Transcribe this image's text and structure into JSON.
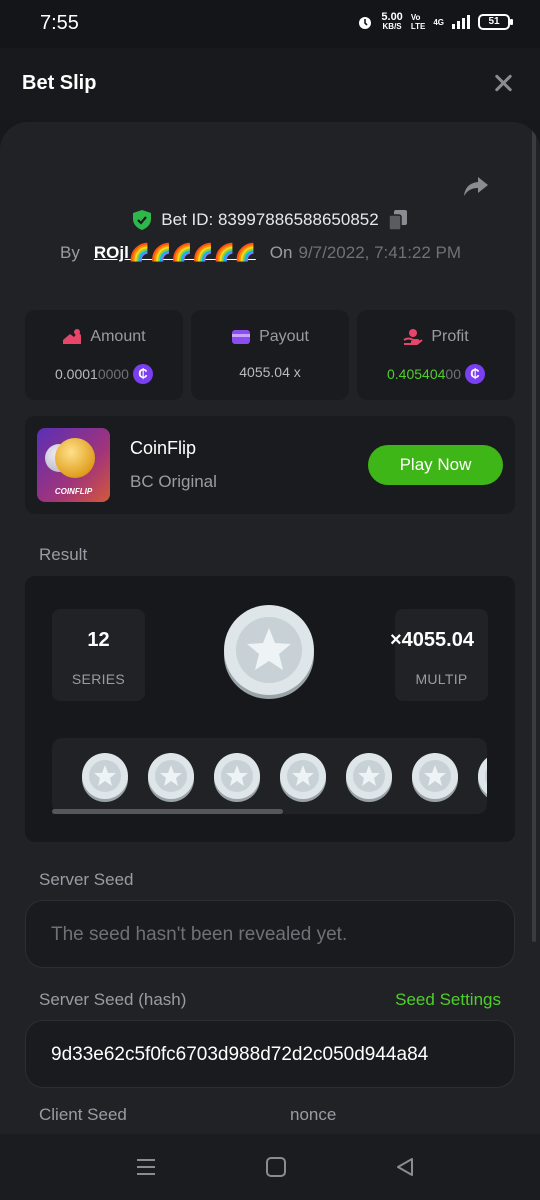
{
  "status_bar": {
    "time": "7:55",
    "speed_value": "5.00",
    "speed_unit": "KB/S",
    "volte_top": "Vo",
    "volte_bottom": "LTE",
    "network": "4G",
    "battery": "51"
  },
  "header": {
    "title": "Bet Slip"
  },
  "bet": {
    "bet_id_label": "Bet ID: 83997886588650852",
    "by_label": "By",
    "username": "ROjl🌈🌈🌈🌈🌈🌈",
    "on_label": "On",
    "date": "9/7/2022, 7:41:22 PM"
  },
  "stats": {
    "amount_label": "Amount",
    "amount_main": "0.0001",
    "amount_dim": "0000",
    "payout_label": "Payout",
    "payout_value": "4055.04 x",
    "profit_label": "Profit",
    "profit_main": "0.405404",
    "profit_dim": "00",
    "currency_symbol": "₵"
  },
  "game": {
    "thumb_label": "COINFLIP",
    "name": "CoinFlip",
    "subtitle": "BC Original",
    "play_label": "Play Now"
  },
  "result": {
    "section_label": "Result",
    "series_value": "12",
    "series_label": "SERIES",
    "multiplier_value": "×4055.04",
    "multiplier_label": "MULTIP"
  },
  "server_seed": {
    "label": "Server Seed",
    "value": "The seed hasn't been revealed yet."
  },
  "server_seed_hash": {
    "label": "Server Seed (hash)",
    "settings_label": "Seed Settings",
    "value": "9d33e62c5f0fc6703d988d72d2c050d944a84"
  },
  "client_seed": {
    "label": "Client Seed",
    "nonce_label": "nonce"
  },
  "colors": {
    "accent_green": "#4fcf2b",
    "button_green": "#3fb618",
    "background": "#212226",
    "card": "#1a1b1e",
    "coin_purple": "#7b3ff2"
  },
  "icons": [
    "shield-check-icon",
    "copy-icon",
    "share-icon",
    "close-icon",
    "amount-icon",
    "payout-wallet-icon",
    "profit-icon",
    "coin-icon",
    "menu-icon",
    "home-icon",
    "back-icon"
  ]
}
